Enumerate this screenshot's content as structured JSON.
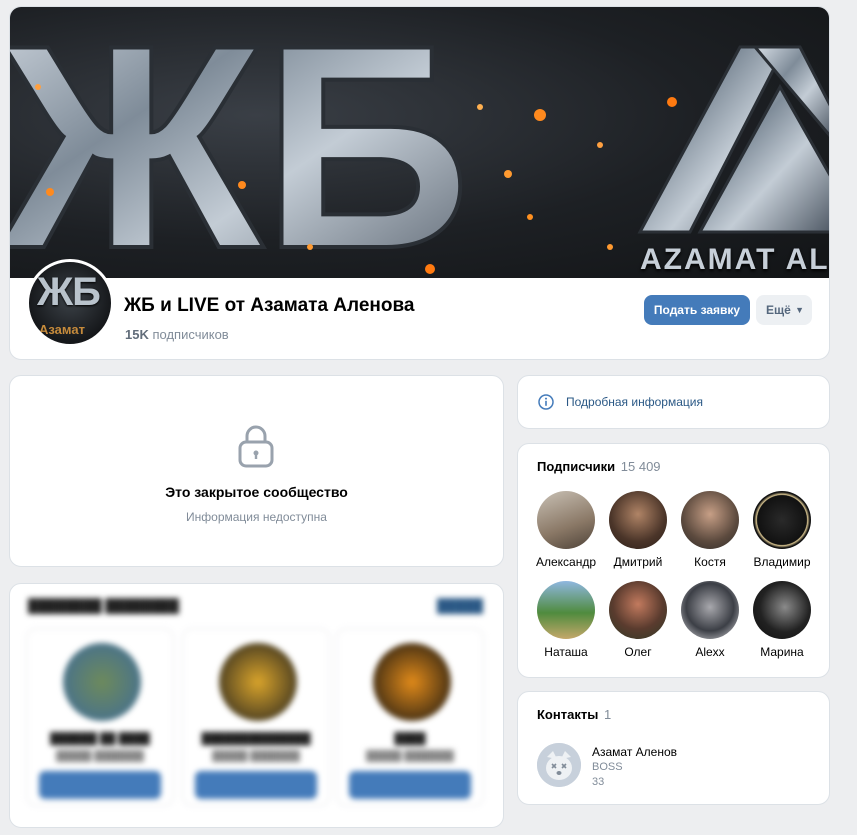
{
  "cover": {
    "letters": "ЖБ",
    "caption": "AZAMAT ALEN"
  },
  "avatar": {
    "letters": "ЖБ",
    "sub": "Азамат"
  },
  "group": {
    "title": "ЖБ и LIVE от Азамата Аленова",
    "subscribers_count": "15K",
    "subscribers_label": "подписчиков"
  },
  "actions": {
    "apply_label": "Подать заявку",
    "more_label": "Ещё"
  },
  "closed": {
    "title": "Это закрытое сообщество",
    "subtitle": "Информация недоступна"
  },
  "info": {
    "link_label": "Подробная информация"
  },
  "subscribers": {
    "title": "Подписчики",
    "count": "15 409",
    "people": [
      {
        "name": "Александр",
        "color": "#9a8a7a"
      },
      {
        "name": "Дмитрий",
        "color": "#5b4636"
      },
      {
        "name": "Костя",
        "color": "#7d6b5c"
      },
      {
        "name": "Владимир",
        "color": "#1f1f1f"
      },
      {
        "name": "Наташа",
        "color": "#6a8f55"
      },
      {
        "name": "Олег",
        "color": "#6b4a3a"
      },
      {
        "name": "Alexx",
        "color": "#3b3f47"
      },
      {
        "name": "Марина",
        "color": "#2b2b2b"
      }
    ]
  },
  "contacts": {
    "title": "Контакты",
    "count": "1",
    "items": [
      {
        "name": "Азамат Аленов",
        "role": "BOSS",
        "number": "33"
      }
    ]
  }
}
